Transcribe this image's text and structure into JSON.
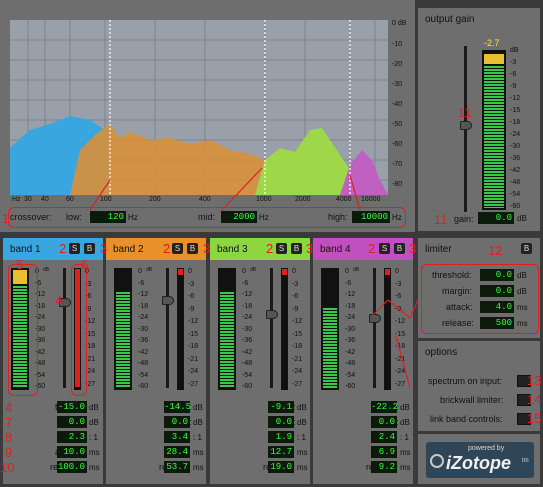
{
  "spectrum": {
    "db_scale": [
      "0 dB",
      "-10",
      "-20",
      "-30",
      "-40",
      "-50",
      "-60",
      "-70",
      "-80"
    ],
    "hz_scale": [
      "Hz",
      "30",
      "40",
      "60",
      "100",
      "200",
      "400",
      "1000",
      "2000",
      "4000",
      "10000",
      "16000"
    ],
    "crossover_label": "crossover:",
    "low_label": "low:",
    "low_value": "120",
    "low_unit": "Hz",
    "mid_label": "mid:",
    "mid_value": "2000",
    "mid_unit": "Hz",
    "high_label": "high:",
    "high_value": "10000",
    "high_unit": "Hz",
    "colors": {
      "band1": "#3aa6e0",
      "band2": "#e8902a",
      "band3": "#8cd640",
      "band4": "#c050c0"
    }
  },
  "output": {
    "title": "output gain",
    "peak": "-2.7",
    "scale": [
      "dB",
      "-3",
      "-6",
      "-9",
      "-12",
      "-15",
      "-18",
      "-24",
      "-30",
      "-36",
      "-42",
      "-48",
      "-54",
      "-60"
    ],
    "gain_label": "gain:",
    "gain_value": "0.0",
    "gain_unit": "dB"
  },
  "scale_left": [
    "0",
    "-6",
    "-12",
    "-18",
    "-24",
    "-30",
    "-36",
    "-42",
    "-48",
    "-54",
    "-60"
  ],
  "scale_right": [
    "0",
    "-3",
    "-6",
    "-9",
    "-12",
    "-15",
    "-18",
    "-21",
    "-24",
    "-27"
  ],
  "db_small": "dB",
  "bands": [
    {
      "title": "band 1",
      "color": "#3aa6e0",
      "thresh": "-15.0",
      "gain": "0.0",
      "ratio": "2.3",
      "attack": "10.0",
      "release": "100.0"
    },
    {
      "title": "band 2",
      "color": "#e8902a",
      "thresh": "-14.5",
      "gain": "0.0",
      "ratio": "3.4",
      "attack": "28.4",
      "release": "53.7"
    },
    {
      "title": "band 3",
      "color": "#8cd640",
      "thresh": "-9.1",
      "gain": "0.0",
      "ratio": "1.9",
      "attack": "12.7",
      "release": "19.0"
    },
    {
      "title": "band 4",
      "color": "#c050c0",
      "thresh": "-22.2",
      "gain": "0.0",
      "ratio": "2.4",
      "attack": "6.9",
      "release": "9.2"
    }
  ],
  "band_labels": {
    "thresh": "thresh:",
    "gain": "gain:",
    "ratio": "ratio:",
    "attack": "attack:",
    "release": "release:"
  },
  "band_units": {
    "thresh": "dB",
    "gain": "dB",
    "ratio": ": 1",
    "attack": "ms",
    "release": "ms"
  },
  "solo_label": "S",
  "bypass_label": "B",
  "limiter": {
    "title": "limiter",
    "threshold_label": "threshold:",
    "threshold_value": "0.0",
    "threshold_unit": "dB",
    "margin_label": "margin:",
    "margin_value": "0.0",
    "margin_unit": "dB",
    "attack_label": "attack:",
    "attack_value": "4.0",
    "attack_unit": "ms",
    "release_label": "release:",
    "release_value": "500",
    "release_unit": "ms"
  },
  "options": {
    "title": "options",
    "spectrum": "spectrum on input:",
    "brickwall": "brickwall limiter:",
    "link": "link band controls:"
  },
  "logo": {
    "powered": "powered by",
    "brand": "iZotope",
    "tm": "tm"
  },
  "markers": {
    "m1": "1",
    "m2": "2",
    "m3": "3",
    "m4": "4",
    "m5": "5",
    "m6": "6",
    "m7": "7",
    "m8": "8",
    "m9": "9",
    "m10": "10",
    "m11": "11",
    "m12": "12",
    "m13": "13",
    "m14": "14",
    "m15": "15"
  }
}
